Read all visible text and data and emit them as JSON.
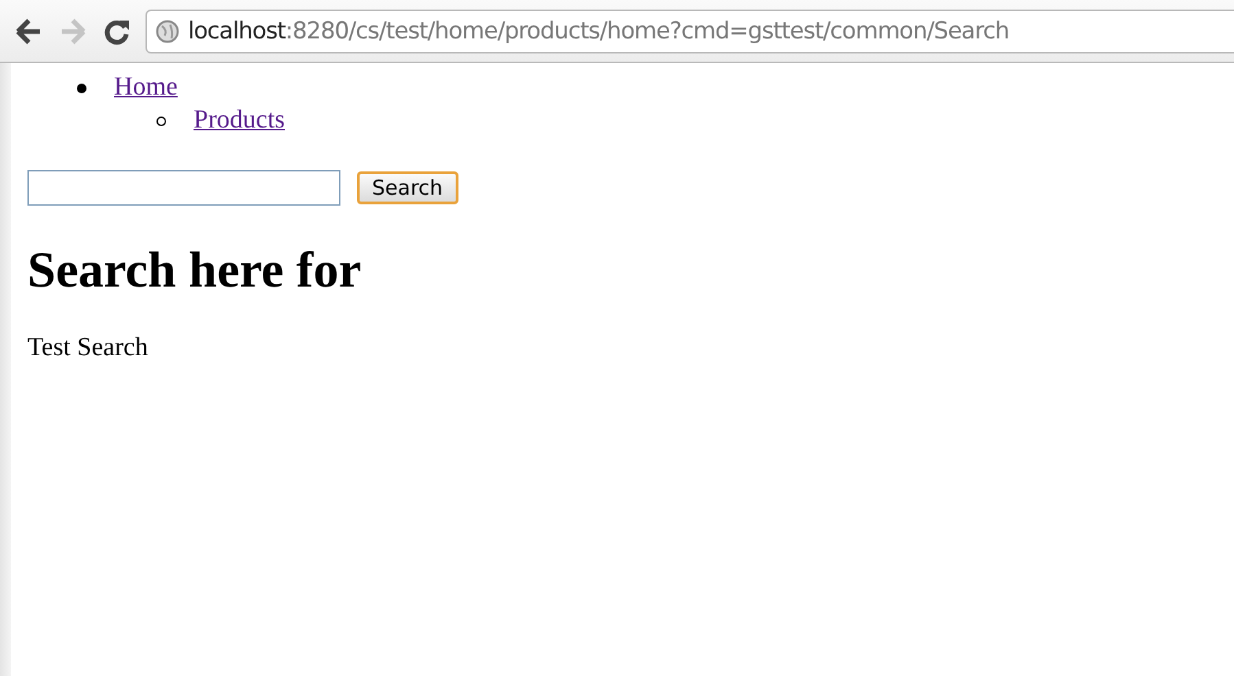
{
  "toolbar": {
    "back": {
      "disabled": false
    },
    "forward": {
      "disabled": true
    },
    "address": {
      "host": "localhost",
      "path": ":8280/cs/test/home/products/home?cmd=gsttest/common/Search"
    }
  },
  "nav": [
    {
      "label": "Home",
      "children": [
        {
          "label": "Products"
        }
      ]
    }
  ],
  "search": {
    "button": "Search"
  },
  "heading": "Search here for",
  "text": "Test Search"
}
